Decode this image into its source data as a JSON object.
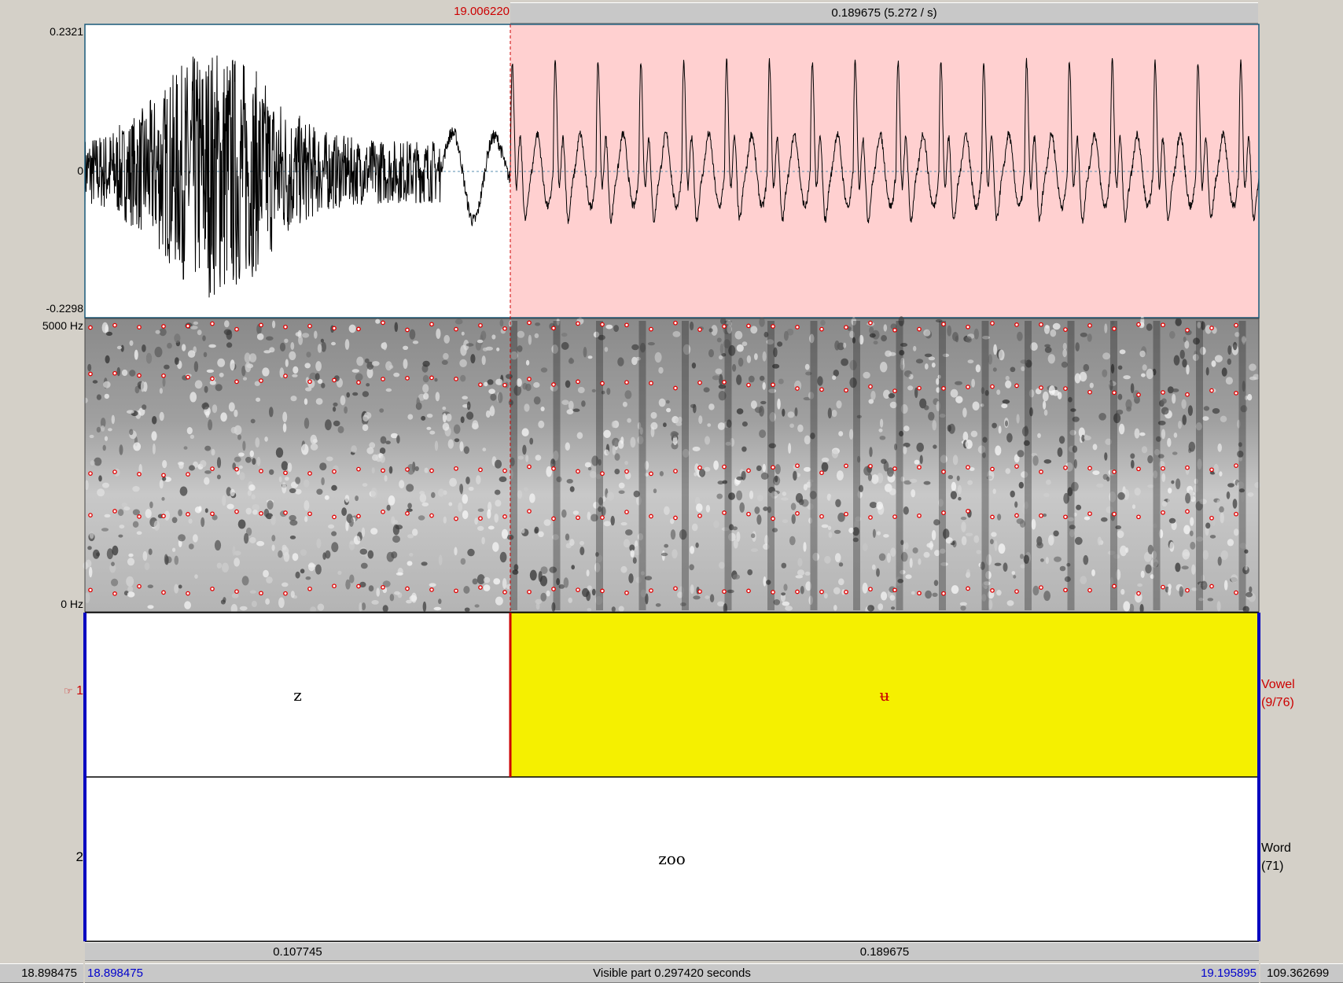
{
  "top": {
    "cursor_time": "19.006220",
    "selection_label": "0.189675 (5.272 / s)"
  },
  "waveform": {
    "max_label": "0.2321",
    "zero_label": "0",
    "min_label": "-0.2298"
  },
  "spectrogram": {
    "max_label": "5000 Hz",
    "min_label": "0 Hz"
  },
  "tiers": [
    {
      "number": "1",
      "pointer_icon": "☞",
      "name": "Vowel",
      "count": "(9/76)",
      "intervals": [
        {
          "text": "z",
          "selected": false
        },
        {
          "text": "ʉ",
          "selected": true
        }
      ]
    },
    {
      "number": "2",
      "name": "Word",
      "count": "(71)",
      "intervals": [
        {
          "text": "zoo",
          "selected": false
        }
      ]
    }
  ],
  "durations": {
    "left": "0.107745",
    "right": "0.189675"
  },
  "bottom": {
    "total_start": "18.898475",
    "visible_start": "18.898475",
    "visible_label": "Visible part 0.297420 seconds",
    "visible_end": "19.195895",
    "total_end": "109.362699"
  },
  "colors": {
    "selection_wave": "#ffd0d0",
    "selected_interval": "#f5f000",
    "cursor": "#cc0000",
    "boundary": "#0000c0",
    "times_blue": "#0000cc"
  }
}
